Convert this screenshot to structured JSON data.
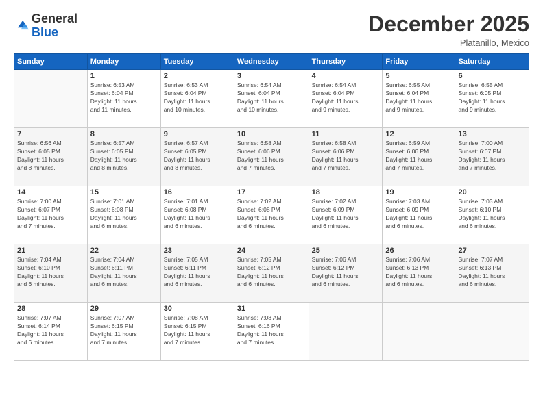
{
  "logo": {
    "general": "General",
    "blue": "Blue"
  },
  "title": "December 2025",
  "subtitle": "Platanillo, Mexico",
  "days": [
    "Sunday",
    "Monday",
    "Tuesday",
    "Wednesday",
    "Thursday",
    "Friday",
    "Saturday"
  ],
  "weeks": [
    [
      {
        "date": "",
        "info": ""
      },
      {
        "date": "1",
        "info": "Sunrise: 6:53 AM\nSunset: 6:04 PM\nDaylight: 11 hours\nand 11 minutes."
      },
      {
        "date": "2",
        "info": "Sunrise: 6:53 AM\nSunset: 6:04 PM\nDaylight: 11 hours\nand 10 minutes."
      },
      {
        "date": "3",
        "info": "Sunrise: 6:54 AM\nSunset: 6:04 PM\nDaylight: 11 hours\nand 10 minutes."
      },
      {
        "date": "4",
        "info": "Sunrise: 6:54 AM\nSunset: 6:04 PM\nDaylight: 11 hours\nand 9 minutes."
      },
      {
        "date": "5",
        "info": "Sunrise: 6:55 AM\nSunset: 6:04 PM\nDaylight: 11 hours\nand 9 minutes."
      },
      {
        "date": "6",
        "info": "Sunrise: 6:55 AM\nSunset: 6:05 PM\nDaylight: 11 hours\nand 9 minutes."
      }
    ],
    [
      {
        "date": "7",
        "info": "Sunrise: 6:56 AM\nSunset: 6:05 PM\nDaylight: 11 hours\nand 8 minutes."
      },
      {
        "date": "8",
        "info": "Sunrise: 6:57 AM\nSunset: 6:05 PM\nDaylight: 11 hours\nand 8 minutes."
      },
      {
        "date": "9",
        "info": "Sunrise: 6:57 AM\nSunset: 6:05 PM\nDaylight: 11 hours\nand 8 minutes."
      },
      {
        "date": "10",
        "info": "Sunrise: 6:58 AM\nSunset: 6:06 PM\nDaylight: 11 hours\nand 7 minutes."
      },
      {
        "date": "11",
        "info": "Sunrise: 6:58 AM\nSunset: 6:06 PM\nDaylight: 11 hours\nand 7 minutes."
      },
      {
        "date": "12",
        "info": "Sunrise: 6:59 AM\nSunset: 6:06 PM\nDaylight: 11 hours\nand 7 minutes."
      },
      {
        "date": "13",
        "info": "Sunrise: 7:00 AM\nSunset: 6:07 PM\nDaylight: 11 hours\nand 7 minutes."
      }
    ],
    [
      {
        "date": "14",
        "info": "Sunrise: 7:00 AM\nSunset: 6:07 PM\nDaylight: 11 hours\nand 7 minutes."
      },
      {
        "date": "15",
        "info": "Sunrise: 7:01 AM\nSunset: 6:08 PM\nDaylight: 11 hours\nand 6 minutes."
      },
      {
        "date": "16",
        "info": "Sunrise: 7:01 AM\nSunset: 6:08 PM\nDaylight: 11 hours\nand 6 minutes."
      },
      {
        "date": "17",
        "info": "Sunrise: 7:02 AM\nSunset: 6:08 PM\nDaylight: 11 hours\nand 6 minutes."
      },
      {
        "date": "18",
        "info": "Sunrise: 7:02 AM\nSunset: 6:09 PM\nDaylight: 11 hours\nand 6 minutes."
      },
      {
        "date": "19",
        "info": "Sunrise: 7:03 AM\nSunset: 6:09 PM\nDaylight: 11 hours\nand 6 minutes."
      },
      {
        "date": "20",
        "info": "Sunrise: 7:03 AM\nSunset: 6:10 PM\nDaylight: 11 hours\nand 6 minutes."
      }
    ],
    [
      {
        "date": "21",
        "info": "Sunrise: 7:04 AM\nSunset: 6:10 PM\nDaylight: 11 hours\nand 6 minutes."
      },
      {
        "date": "22",
        "info": "Sunrise: 7:04 AM\nSunset: 6:11 PM\nDaylight: 11 hours\nand 6 minutes."
      },
      {
        "date": "23",
        "info": "Sunrise: 7:05 AM\nSunset: 6:11 PM\nDaylight: 11 hours\nand 6 minutes."
      },
      {
        "date": "24",
        "info": "Sunrise: 7:05 AM\nSunset: 6:12 PM\nDaylight: 11 hours\nand 6 minutes."
      },
      {
        "date": "25",
        "info": "Sunrise: 7:06 AM\nSunset: 6:12 PM\nDaylight: 11 hours\nand 6 minutes."
      },
      {
        "date": "26",
        "info": "Sunrise: 7:06 AM\nSunset: 6:13 PM\nDaylight: 11 hours\nand 6 minutes."
      },
      {
        "date": "27",
        "info": "Sunrise: 7:07 AM\nSunset: 6:13 PM\nDaylight: 11 hours\nand 6 minutes."
      }
    ],
    [
      {
        "date": "28",
        "info": "Sunrise: 7:07 AM\nSunset: 6:14 PM\nDaylight: 11 hours\nand 6 minutes."
      },
      {
        "date": "29",
        "info": "Sunrise: 7:07 AM\nSunset: 6:15 PM\nDaylight: 11 hours\nand 7 minutes."
      },
      {
        "date": "30",
        "info": "Sunrise: 7:08 AM\nSunset: 6:15 PM\nDaylight: 11 hours\nand 7 minutes."
      },
      {
        "date": "31",
        "info": "Sunrise: 7:08 AM\nSunset: 6:16 PM\nDaylight: 11 hours\nand 7 minutes."
      },
      {
        "date": "",
        "info": ""
      },
      {
        "date": "",
        "info": ""
      },
      {
        "date": "",
        "info": ""
      }
    ]
  ]
}
